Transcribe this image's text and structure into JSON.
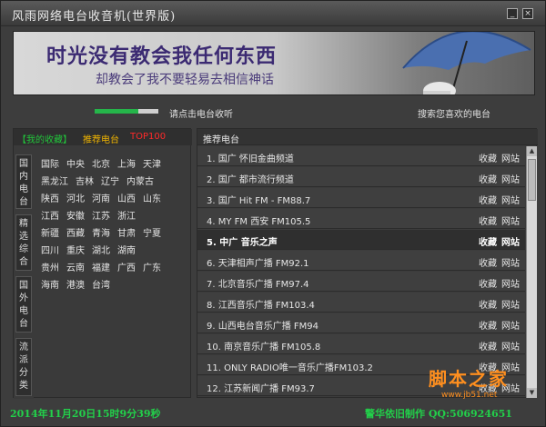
{
  "window": {
    "title": "风雨网络电台收音机(世界版)",
    "minimize_glyph": "_",
    "close_glyph": "×"
  },
  "banner": {
    "headline": "时光没有教会我任何东西",
    "subline": "却教会了我不要轻易去相信神话"
  },
  "controls": {
    "volume_level": 0.68,
    "hint_left": "请点击电台收听",
    "hint_right": "搜索您喜欢的电台"
  },
  "left": {
    "tabs": [
      "【我的收藏】",
      "推荐电台",
      "TOP100"
    ],
    "vertical_tabs": [
      "国内电台",
      "精选综合",
      "国外电台",
      "流派分类"
    ],
    "regions": [
      [
        "国际",
        "中央",
        "北京",
        "上海",
        "天津"
      ],
      [
        "黑龙江",
        "吉林",
        "辽宁",
        "内蒙古"
      ],
      [
        "陕西",
        "河北",
        "河南",
        "山西",
        "山东"
      ],
      [
        "江西",
        "安徽",
        "江苏",
        "浙江"
      ],
      [
        "新疆",
        "西藏",
        "青海",
        "甘肃",
        "宁夏"
      ],
      [
        "四川",
        "重庆",
        "湖北",
        "湖南"
      ],
      [
        "贵州",
        "云南",
        "福建",
        "广西",
        "广东"
      ],
      [
        "海南",
        "港澳",
        "台湾"
      ]
    ]
  },
  "right": {
    "header": "推荐电台",
    "fav_label": "收藏",
    "site_label": "网站",
    "selected_index": 4,
    "stations": [
      "1. 国广  怀旧金曲频道",
      "2. 国广  都市流行频道",
      "3. 国广  Hit FM - FM88.7",
      "4. MY FM 西安 FM105.5",
      "5. 中广  音乐之声",
      "6. 天津相声广播 FM92.1",
      "7. 北京音乐广播 FM97.4",
      "8. 江西音乐广播 FM103.4",
      "9. 山西电台音乐广播 FM94",
      "10. 南京音乐广播 FM105.8",
      "11. ONLY RADIO唯一音乐广播FM103.2",
      "12. 江苏新闻广播  FM93.7"
    ]
  },
  "status": {
    "time": "2014年11月20日15时9分39秒",
    "credit": "警华依旧制作  QQ:506924651"
  },
  "watermark": {
    "big": "脚本之家",
    "small": "www.jb51.net"
  }
}
